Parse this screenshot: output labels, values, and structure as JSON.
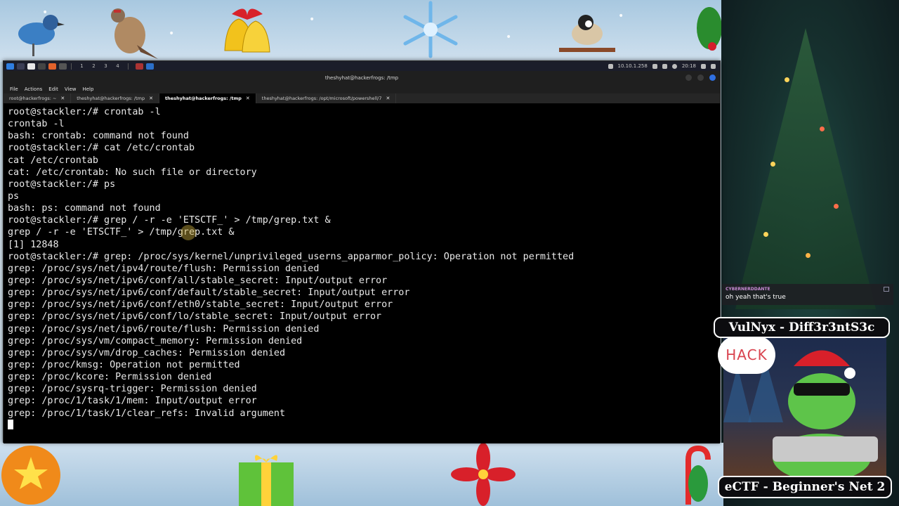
{
  "window": {
    "title": "theshyhat@hackerfrogs: /tmp",
    "taskbar": {
      "workspaces": [
        "1",
        "2",
        "3",
        "4"
      ],
      "ip": "10.10.1.258",
      "clock": "20:18"
    },
    "menu": [
      "File",
      "Actions",
      "Edit",
      "View",
      "Help"
    ],
    "tabs": [
      {
        "label": "root@hackerfrogs: ~",
        "active": false
      },
      {
        "label": "theshyhat@hackerfrogs: /tmp",
        "active": false
      },
      {
        "label": "theshyhat@hackerfrogs: /tmp",
        "active": true
      },
      {
        "label": "theshyhat@hackerfrogs: /opt/microsoft/powershell/7",
        "active": false
      }
    ]
  },
  "terminal": {
    "lines": [
      "root@stackler:/# crontab -l",
      "crontab -l",
      "bash: crontab: command not found",
      "root@stackler:/# cat /etc/crontab",
      "cat /etc/crontab",
      "cat: /etc/crontab: No such file or directory",
      "root@stackler:/# ps",
      "ps",
      "bash: ps: command not found",
      "root@stackler:/# grep / -r -e 'ETSCTF_' > /tmp/grep.txt &",
      "grep / -r -e 'ETSCTF_' > /tmp/grep.txt &",
      "[1] 12848",
      "root@stackler:/# grep: /proc/sys/kernel/unprivileged_userns_apparmor_policy: Operation not permitted",
      "grep: /proc/sys/net/ipv4/route/flush: Permission denied",
      "grep: /proc/sys/net/ipv6/conf/all/stable_secret: Input/output error",
      "grep: /proc/sys/net/ipv6/conf/default/stable_secret: Input/output error",
      "grep: /proc/sys/net/ipv6/conf/eth0/stable_secret: Input/output error",
      "grep: /proc/sys/net/ipv6/conf/lo/stable_secret: Input/output error",
      "grep: /proc/sys/net/ipv6/route/flush: Permission denied",
      "grep: /proc/sys/vm/compact_memory: Permission denied",
      "grep: /proc/sys/vm/drop_caches: Permission denied",
      "grep: /proc/kmsg: Operation not permitted",
      "grep: /proc/kcore: Permission denied",
      "grep: /proc/sysrq-trigger: Permission denied",
      "grep: /proc/1/task/1/mem: Input/output error",
      "grep: /proc/1/task/1/clear_refs: Invalid argument"
    ]
  },
  "chat": {
    "user": "CYBERNERDDANTE",
    "message": "oh yeah that's true"
  },
  "overlay": {
    "top_banner": "VulNyx - Diff3r3ntS3c",
    "bottom_banner": "eCTF - Beginner's Net 2",
    "hack_text": "HACK"
  },
  "colors": {
    "terminal_bg": "#000000",
    "terminal_fg": "#e9e9e9",
    "banner_bg": "#0c0c0f",
    "hack_red": "#d9434f"
  },
  "icons": [
    "kali-menu-icon",
    "bell-icon",
    "snowflake-icon",
    "holly-icon",
    "gift-icon",
    "poinsettia-icon",
    "candy-cane-icon",
    "ornament-icon"
  ]
}
